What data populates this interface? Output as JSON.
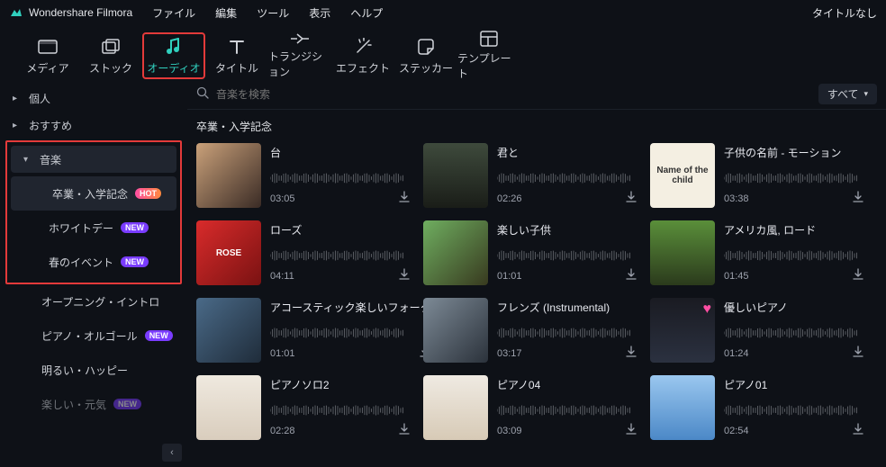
{
  "app_name": "Wondershare Filmora",
  "titlebar_untitled": "タイトルなし",
  "menus": [
    "ファイル",
    "編集",
    "ツール",
    "表示",
    "ヘルプ"
  ],
  "tool_tabs": {
    "media": "メディア",
    "stock": "ストック",
    "audio": "オーディオ",
    "title": "タイトル",
    "transition": "トランジション",
    "effect": "エフェクト",
    "sticker": "ステッカー",
    "template": "テンプレート"
  },
  "sidebar": {
    "personal": "個人",
    "recommended": "おすすめ",
    "music": "音楽",
    "items": [
      {
        "label": "卒業・入学記念",
        "badge": "HOT",
        "badge_kind": "hot"
      },
      {
        "label": "ホワイトデー",
        "badge": "NEW",
        "badge_kind": "new"
      },
      {
        "label": "春のイベント",
        "badge": "NEW",
        "badge_kind": "new"
      }
    ],
    "below": [
      {
        "label": "オープニング・イントロ",
        "badge": ""
      },
      {
        "label": "ピアノ・オルゴール",
        "badge": "NEW",
        "badge_kind": "new"
      },
      {
        "label": "明るい・ハッピー",
        "badge": ""
      },
      {
        "label": "楽しい・元気",
        "badge": "NEW",
        "badge_kind": "new"
      }
    ]
  },
  "search": {
    "placeholder": "音楽を検索"
  },
  "filter": {
    "label": "すべて"
  },
  "section_title": "卒業・入学記念",
  "tracks": [
    {
      "title": "台",
      "dur": "03:05",
      "thumb": "th1"
    },
    {
      "title": "君と",
      "dur": "02:26",
      "thumb": "th2"
    },
    {
      "title": "子供の名前 - モーション",
      "dur": "03:38",
      "thumb": "th3",
      "overlay": "Name of the child"
    },
    {
      "title": "ローズ",
      "dur": "04:11",
      "thumb": "th4",
      "overlay": "ROSE"
    },
    {
      "title": "楽しい子供",
      "dur": "01:01",
      "thumb": "th5"
    },
    {
      "title": "アメリカ風, ロード",
      "dur": "01:45",
      "thumb": "th6"
    },
    {
      "title": "アコースティック楽しいフォーク",
      "dur": "01:01",
      "thumb": "th7"
    },
    {
      "title": "フレンズ (Instrumental)",
      "dur": "03:17",
      "thumb": "th8"
    },
    {
      "title": "優しいピアノ",
      "dur": "01:24",
      "thumb": "th9",
      "heart": true
    },
    {
      "title": "ピアノソロ2",
      "dur": "02:28",
      "thumb": "th10"
    },
    {
      "title": "ピアノ04",
      "dur": "03:09",
      "thumb": "th11"
    },
    {
      "title": "ピアノ01",
      "dur": "02:54",
      "thumb": "th12"
    }
  ]
}
